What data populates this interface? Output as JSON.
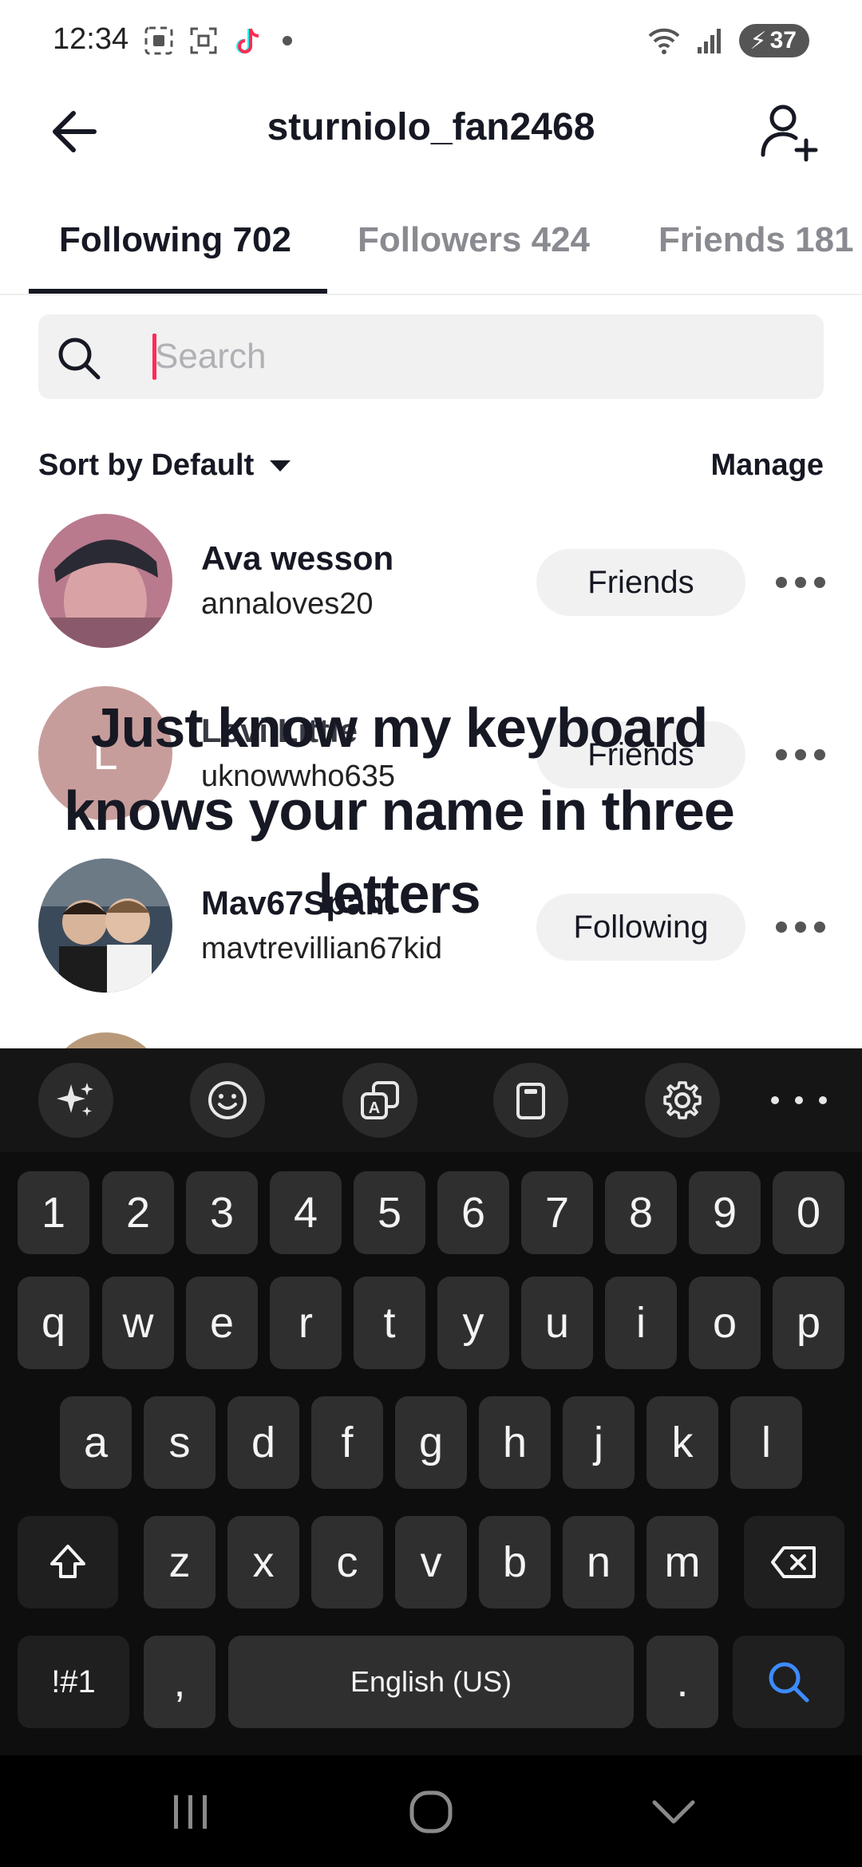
{
  "status_bar": {
    "time": "12:34",
    "battery": "37",
    "left_icons": [
      "screen-record-icon",
      "screenshot-icon",
      "tiktok-icon"
    ],
    "right_icons": [
      "wifi-icon",
      "signal-icon",
      "battery-icon"
    ]
  },
  "header": {
    "title": "sturniolo_fan2468",
    "back_icon": "back-arrow-icon",
    "add_icon": "add-user-icon"
  },
  "tabs": [
    {
      "label": "Following 702",
      "active": true
    },
    {
      "label": "Followers 424",
      "active": false
    },
    {
      "label": "Friends 181",
      "active": false
    }
  ],
  "search": {
    "placeholder": "Search",
    "value": ""
  },
  "sort": {
    "label": "Sort by Default",
    "manage_label": "Manage"
  },
  "list": [
    {
      "name": "Ava wesson",
      "handle": "annaloves20",
      "button": "Friends",
      "avatar_letter": ""
    },
    {
      "name": "Levi Little",
      "handle": "uknowwho635",
      "button": "Friends",
      "avatar_letter": "L"
    },
    {
      "name": "Mav67Spam",
      "handle": "mavtrevillian67kid",
      "button": "Following",
      "avatar_letter": ""
    }
  ],
  "caption": {
    "lines": [
      "Just know my keyboard",
      "knows your name in three",
      "letters"
    ]
  },
  "keyboard": {
    "toolbar": [
      "sparkle-icon",
      "emoji-icon",
      "translate-icon",
      "clipboard-icon",
      "settings-icon",
      "more-icon"
    ],
    "row_numbers": [
      "1",
      "2",
      "3",
      "4",
      "5",
      "6",
      "7",
      "8",
      "9",
      "0"
    ],
    "row_1": [
      "q",
      "w",
      "e",
      "r",
      "t",
      "y",
      "u",
      "i",
      "o",
      "p"
    ],
    "row_2": [
      "a",
      "s",
      "d",
      "f",
      "g",
      "h",
      "j",
      "k",
      "l"
    ],
    "row_3": [
      "z",
      "x",
      "c",
      "v",
      "b",
      "n",
      "m"
    ],
    "symbols_label": "!#1",
    "comma": ",",
    "space_label": "English (US)",
    "period": ".",
    "accent_color": "#3d8bff"
  },
  "nav": [
    "recents-icon",
    "home-icon",
    "back-chevron-icon"
  ]
}
